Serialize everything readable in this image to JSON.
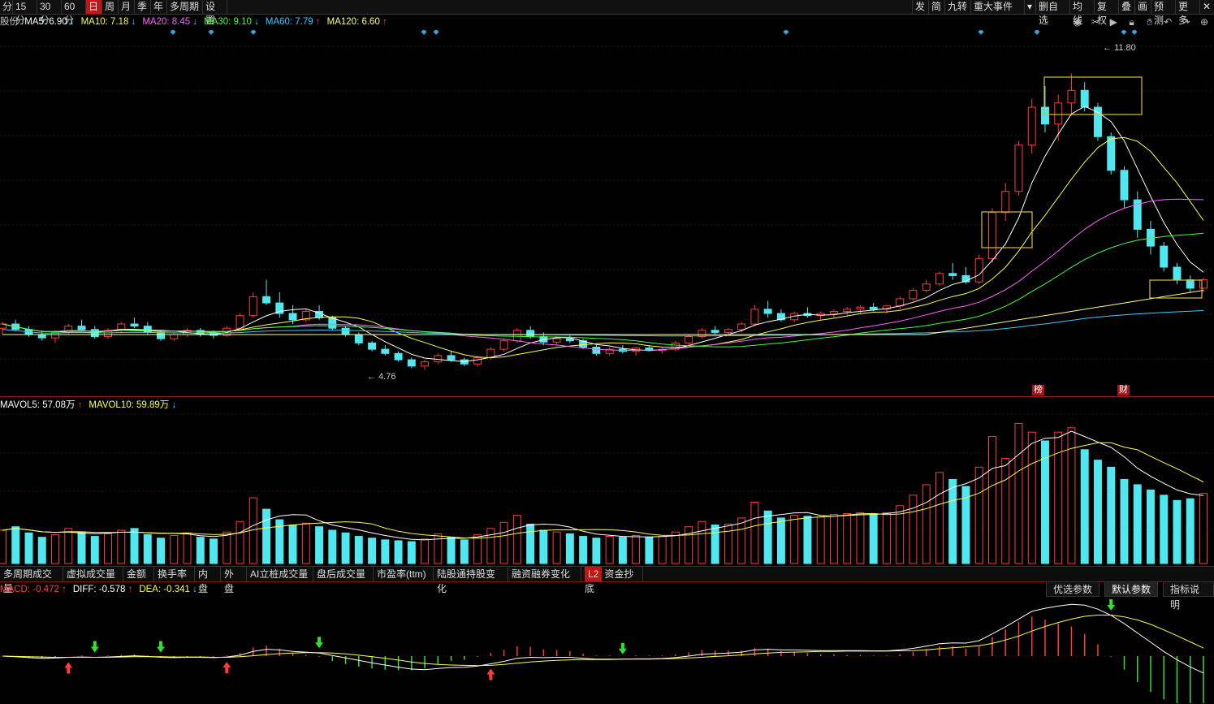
{
  "toolbar": {
    "left": [
      {
        "label": "分",
        "active": false
      },
      {
        "label": "15分",
        "active": false
      },
      {
        "label": "30分",
        "active": false
      },
      {
        "label": "60分",
        "active": false
      },
      {
        "label": "日",
        "active": true
      },
      {
        "label": "周",
        "active": false
      },
      {
        "label": "月",
        "active": false
      },
      {
        "label": "季",
        "active": false
      },
      {
        "label": "年",
        "active": false
      },
      {
        "label": "多周期",
        "active": false
      },
      {
        "label": "设置",
        "active": false
      }
    ],
    "right": [
      "发",
      "简",
      "九转",
      "重大事件",
      "▾",
      "删自选",
      "均线",
      "复权",
      "叠",
      "画",
      "预测",
      "更多",
      "✕"
    ]
  },
  "ma_legend": {
    "name": "股份",
    "items": [
      {
        "label": "MA5: 6.90",
        "dir": "↓",
        "color": "#ffffff"
      },
      {
        "label": "MA10: 7.18",
        "dir": "↓",
        "color": "#ffff40"
      },
      {
        "label": "MA20: 8.45",
        "dir": "↓",
        "color": "#ff60ff"
      },
      {
        "label": "MA30: 9.10",
        "dir": "↓",
        "color": "#40ff40"
      },
      {
        "label": "MA60: 7.79",
        "dir": "↑",
        "color": "#40c8ff"
      },
      {
        "label": "MA120: 6.60",
        "dir": "↑",
        "color": "#ffff80"
      }
    ]
  },
  "tool_icons": [
    "eye-icon",
    "scissors-icon",
    "play-icon",
    "lock-icon",
    "hand-icon",
    "undo-icon",
    "redo-icon",
    "add-icon"
  ],
  "price_labels": {
    "high": "11.80",
    "low": "4.76"
  },
  "markers": {
    "bang": "榜",
    "cai": "财"
  },
  "vol_legend": [
    {
      "label": "MAVOL5: 57.08万",
      "dir": "↑",
      "color": "#ffffff"
    },
    {
      "label": "MAVOL10: 59.89万",
      "dir": "↓",
      "color": "#ffff40"
    }
  ],
  "indicator_tabs": [
    "多周期成交量",
    "虚拟成交量",
    "金额",
    "换手率",
    "内盘",
    "外盘",
    "AI立桩成交量",
    "盘后成交量",
    "市盈率(ttm)",
    "陆股通持股变化",
    "融资融券变化",
    "资金抄底"
  ],
  "l2_badge": "L2",
  "macd_legend": [
    {
      "label": "MACD: -0.472",
      "dir": "↑",
      "color": "#ff4040"
    },
    {
      "label": "DIFF: -0.578",
      "dir": "↑",
      "color": "#ffffff"
    },
    {
      "label": "DEA: -0.341",
      "dir": "↓",
      "color": "#ffff40"
    }
  ],
  "macd_buttons": [
    "优选参数",
    "默认参数",
    "指标说明"
  ],
  "chart_data": {
    "type": "candlestick",
    "price_min": 4.76,
    "price_max": 11.8,
    "series": [
      {
        "name": "MA5",
        "color": "#ffffff"
      },
      {
        "name": "MA10",
        "color": "#ffff40"
      },
      {
        "name": "MA20",
        "color": "#ff60ff"
      },
      {
        "name": "MA30",
        "color": "#40ff40"
      },
      {
        "name": "MA60",
        "color": "#40c8ff"
      },
      {
        "name": "MA120",
        "color": "#ffff80"
      }
    ],
    "candles": [
      [
        5.75,
        5.9,
        5.6,
        5.85
      ],
      [
        5.85,
        5.95,
        5.7,
        5.72
      ],
      [
        5.72,
        5.8,
        5.55,
        5.6
      ],
      [
        5.6,
        5.7,
        5.45,
        5.52
      ],
      [
        5.52,
        5.7,
        5.4,
        5.65
      ],
      [
        5.65,
        5.85,
        5.6,
        5.8
      ],
      [
        5.8,
        5.95,
        5.7,
        5.72
      ],
      [
        5.72,
        5.8,
        5.5,
        5.55
      ],
      [
        5.55,
        5.75,
        5.5,
        5.7
      ],
      [
        5.7,
        5.9,
        5.65,
        5.85
      ],
      [
        5.85,
        6.0,
        5.75,
        5.8
      ],
      [
        5.8,
        5.9,
        5.6,
        5.65
      ],
      [
        5.65,
        5.7,
        5.45,
        5.5
      ],
      [
        5.5,
        5.65,
        5.45,
        5.6
      ],
      [
        5.6,
        5.75,
        5.55,
        5.7
      ],
      [
        5.7,
        5.75,
        5.55,
        5.62
      ],
      [
        5.62,
        5.7,
        5.5,
        5.58
      ],
      [
        5.58,
        5.8,
        5.55,
        5.75
      ],
      [
        5.75,
        6.1,
        5.7,
        6.05
      ],
      [
        6.05,
        6.6,
        6.0,
        6.5
      ],
      [
        6.5,
        6.9,
        6.3,
        6.35
      ],
      [
        6.35,
        6.6,
        6.0,
        6.1
      ],
      [
        6.1,
        6.3,
        5.85,
        5.95
      ],
      [
        5.95,
        6.2,
        5.9,
        6.15
      ],
      [
        6.15,
        6.3,
        5.95,
        6.0
      ],
      [
        6.0,
        6.05,
        5.7,
        5.75
      ],
      [
        5.75,
        5.8,
        5.55,
        5.6
      ],
      [
        5.6,
        5.65,
        5.35,
        5.4
      ],
      [
        5.4,
        5.45,
        5.2,
        5.25
      ],
      [
        5.25,
        5.35,
        5.1,
        5.15
      ],
      [
        5.15,
        5.2,
        4.95,
        5.0
      ],
      [
        5.0,
        5.05,
        4.8,
        4.85
      ],
      [
        4.85,
        5.0,
        4.76,
        4.95
      ],
      [
        4.95,
        5.15,
        4.9,
        5.1
      ],
      [
        5.1,
        5.2,
        4.95,
        5.0
      ],
      [
        5.0,
        5.05,
        4.85,
        4.9
      ],
      [
        4.9,
        5.1,
        4.85,
        5.05
      ],
      [
        5.05,
        5.3,
        5.0,
        5.25
      ],
      [
        5.25,
        5.5,
        5.2,
        5.45
      ],
      [
        5.45,
        5.75,
        5.4,
        5.7
      ],
      [
        5.7,
        5.8,
        5.5,
        5.55
      ],
      [
        5.55,
        5.65,
        5.35,
        5.42
      ],
      [
        5.42,
        5.55,
        5.35,
        5.5
      ],
      [
        5.5,
        5.6,
        5.4,
        5.45
      ],
      [
        5.45,
        5.5,
        5.25,
        5.3
      ],
      [
        5.3,
        5.35,
        5.1,
        5.15
      ],
      [
        5.15,
        5.3,
        5.1,
        5.25
      ],
      [
        5.25,
        5.35,
        5.15,
        5.2
      ],
      [
        5.2,
        5.3,
        5.1,
        5.28
      ],
      [
        5.28,
        5.35,
        5.2,
        5.22
      ],
      [
        5.22,
        5.3,
        5.15,
        5.25
      ],
      [
        5.25,
        5.45,
        5.2,
        5.4
      ],
      [
        5.4,
        5.6,
        5.35,
        5.55
      ],
      [
        5.55,
        5.75,
        5.5,
        5.7
      ],
      [
        5.7,
        5.8,
        5.6,
        5.65
      ],
      [
        5.65,
        5.75,
        5.6,
        5.72
      ],
      [
        5.72,
        5.9,
        5.65,
        5.85
      ],
      [
        5.85,
        6.3,
        5.8,
        6.2
      ],
      [
        6.2,
        6.4,
        6.0,
        6.1
      ],
      [
        6.1,
        6.2,
        5.9,
        5.95
      ],
      [
        5.95,
        6.15,
        5.9,
        6.1
      ],
      [
        6.1,
        6.25,
        6.0,
        6.05
      ],
      [
        6.05,
        6.15,
        5.95,
        6.1
      ],
      [
        6.1,
        6.2,
        6.0,
        6.15
      ],
      [
        6.15,
        6.25,
        6.05,
        6.2
      ],
      [
        6.2,
        6.3,
        6.1,
        6.25
      ],
      [
        6.25,
        6.35,
        6.15,
        6.2
      ],
      [
        6.2,
        6.3,
        6.1,
        6.28
      ],
      [
        6.28,
        6.5,
        6.2,
        6.45
      ],
      [
        6.45,
        6.7,
        6.4,
        6.65
      ],
      [
        6.65,
        6.9,
        6.6,
        6.8
      ],
      [
        6.8,
        7.1,
        6.75,
        7.05
      ],
      [
        7.05,
        7.3,
        6.9,
        7.0
      ],
      [
        7.0,
        7.2,
        6.8,
        6.85
      ],
      [
        6.85,
        7.5,
        6.8,
        7.4
      ],
      [
        7.4,
        8.6,
        7.3,
        8.5
      ],
      [
        8.5,
        9.2,
        8.3,
        9.0
      ],
      [
        9.0,
        10.2,
        8.9,
        10.1
      ],
      [
        10.1,
        11.2,
        9.9,
        11.0
      ],
      [
        11.0,
        11.5,
        10.4,
        10.6
      ],
      [
        10.6,
        11.3,
        10.2,
        11.1
      ],
      [
        11.1,
        11.8,
        10.8,
        11.4
      ],
      [
        11.4,
        11.6,
        10.9,
        11.0
      ],
      [
        11.0,
        11.1,
        10.2,
        10.3
      ],
      [
        10.3,
        10.4,
        9.4,
        9.5
      ],
      [
        9.5,
        9.6,
        8.6,
        8.8
      ],
      [
        8.8,
        9.0,
        7.9,
        8.1
      ],
      [
        8.1,
        8.3,
        7.5,
        7.7
      ],
      [
        7.7,
        7.8,
        7.1,
        7.2
      ],
      [
        7.2,
        7.3,
        6.8,
        6.9
      ],
      [
        6.9,
        7.0,
        6.6,
        6.7
      ],
      [
        6.7,
        6.95,
        6.6,
        6.9
      ]
    ],
    "volume_unit": "万",
    "volume": [
      38,
      42,
      35,
      30,
      33,
      40,
      36,
      31,
      34,
      38,
      40,
      33,
      29,
      32,
      35,
      30,
      28,
      36,
      48,
      75,
      62,
      50,
      44,
      46,
      42,
      38,
      35,
      31,
      29,
      27,
      26,
      25,
      28,
      34,
      30,
      27,
      33,
      40,
      47,
      55,
      45,
      38,
      36,
      34,
      31,
      29,
      31,
      30,
      32,
      30,
      31,
      36,
      42,
      48,
      44,
      45,
      52,
      70,
      60,
      52,
      55,
      54,
      53,
      56,
      57,
      58,
      56,
      58,
      66,
      78,
      90,
      104,
      96,
      88,
      110,
      145,
      120,
      160,
      150,
      140,
      150,
      155,
      130,
      118,
      110,
      96,
      90,
      84,
      78,
      72,
      74,
      80
    ],
    "macd": {
      "diff": [
        0.0,
        -0.02,
        -0.05,
        -0.07,
        -0.06,
        -0.04,
        -0.03,
        -0.04,
        -0.03,
        -0.01,
        0.01,
        -0.01,
        -0.04,
        -0.05,
        -0.04,
        -0.04,
        -0.05,
        -0.03,
        0.03,
        0.15,
        0.22,
        0.2,
        0.15,
        0.13,
        0.1,
        0.02,
        -0.06,
        -0.14,
        -0.22,
        -0.29,
        -0.36,
        -0.42,
        -0.44,
        -0.4,
        -0.37,
        -0.36,
        -0.32,
        -0.25,
        -0.17,
        -0.07,
        -0.04,
        -0.05,
        -0.04,
        -0.04,
        -0.07,
        -0.1,
        -0.1,
        -0.1,
        -0.09,
        -0.09,
        -0.08,
        -0.05,
        0.0,
        0.06,
        0.08,
        0.1,
        0.13,
        0.2,
        0.22,
        0.2,
        0.2,
        0.19,
        0.18,
        0.18,
        0.18,
        0.18,
        0.17,
        0.17,
        0.2,
        0.25,
        0.32,
        0.4,
        0.43,
        0.42,
        0.5,
        0.72,
        0.95,
        1.2,
        1.45,
        1.55,
        1.62,
        1.68,
        1.65,
        1.52,
        1.32,
        1.05,
        0.75,
        0.45,
        0.15,
        -0.12,
        -0.35,
        -0.55
      ],
      "dea": [
        0.0,
        -0.01,
        -0.02,
        -0.03,
        -0.04,
        -0.04,
        -0.04,
        -0.04,
        -0.04,
        -0.03,
        -0.02,
        -0.02,
        -0.02,
        -0.03,
        -0.03,
        -0.03,
        -0.04,
        -0.04,
        -0.02,
        0.01,
        0.05,
        0.08,
        0.1,
        0.11,
        0.11,
        0.1,
        0.07,
        0.03,
        -0.02,
        -0.07,
        -0.13,
        -0.19,
        -0.24,
        -0.27,
        -0.29,
        -0.3,
        -0.31,
        -0.3,
        -0.27,
        -0.23,
        -0.19,
        -0.16,
        -0.14,
        -0.12,
        -0.11,
        -0.11,
        -0.11,
        -0.1,
        -0.1,
        -0.1,
        -0.09,
        -0.08,
        -0.06,
        -0.04,
        -0.01,
        0.01,
        0.04,
        0.07,
        0.1,
        0.12,
        0.13,
        0.14,
        0.15,
        0.15,
        0.16,
        0.16,
        0.16,
        0.16,
        0.17,
        0.18,
        0.2,
        0.24,
        0.27,
        0.3,
        0.34,
        0.41,
        0.52,
        0.65,
        0.81,
        0.96,
        1.09,
        1.2,
        1.29,
        1.33,
        1.33,
        1.27,
        1.17,
        1.03,
        0.85,
        0.66,
        0.46,
        0.26
      ]
    }
  }
}
